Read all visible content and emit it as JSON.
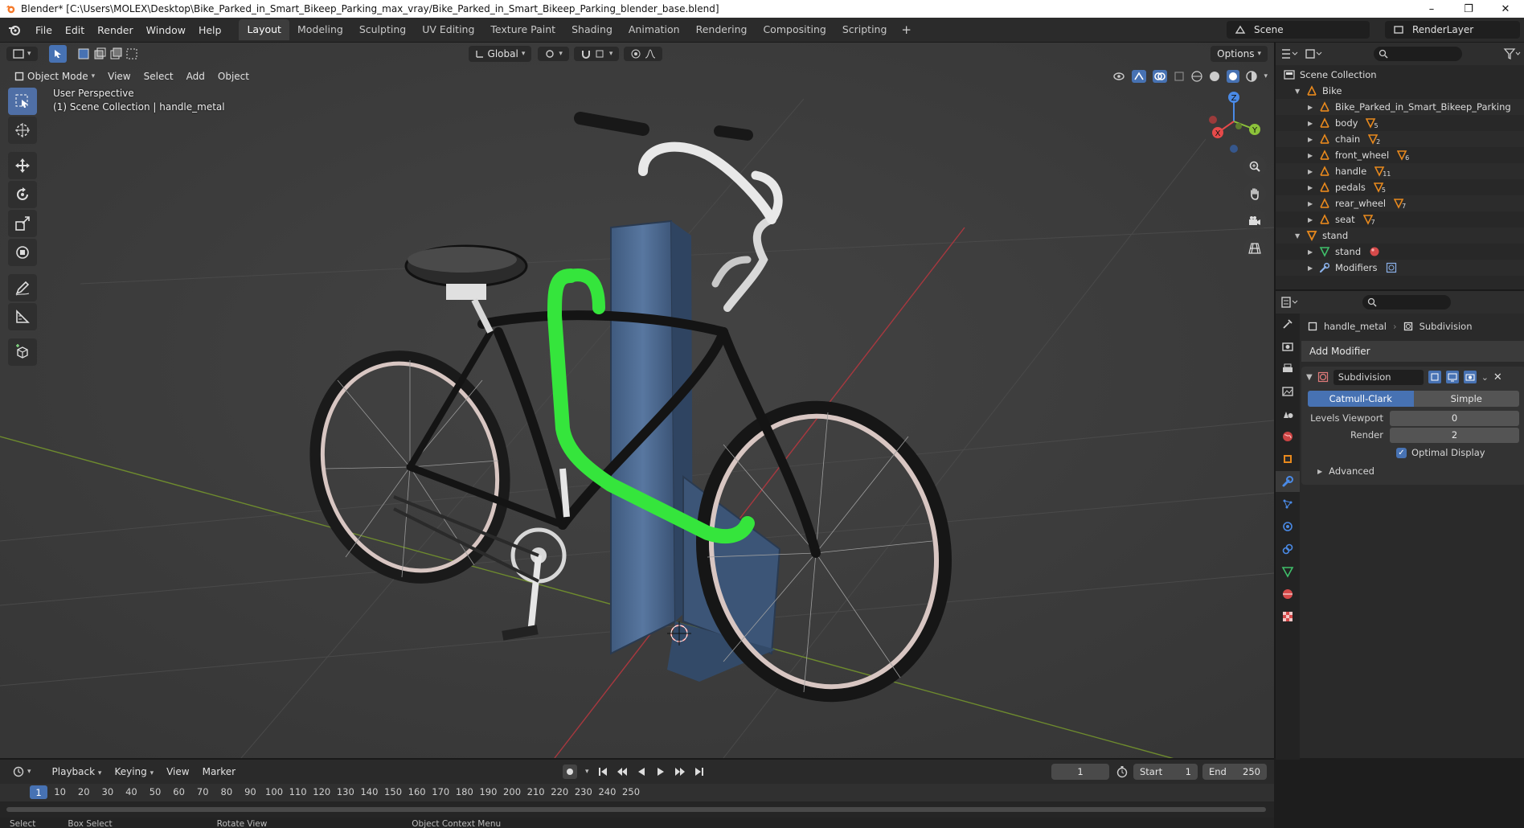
{
  "window": {
    "title": "Blender* [C:\\Users\\MOLEX\\Desktop\\Bike_Parked_in_Smart_Bikeep_Parking_max_vray/Bike_Parked_in_Smart_Bikeep_Parking_blender_base.blend]",
    "controls": [
      "–",
      "❐",
      "✕"
    ]
  },
  "menu": [
    "File",
    "Edit",
    "Render",
    "Window",
    "Help"
  ],
  "workspaces": [
    "Layout",
    "Modeling",
    "Sculpting",
    "UV Editing",
    "Texture Paint",
    "Shading",
    "Animation",
    "Rendering",
    "Compositing",
    "Scripting"
  ],
  "active_workspace": "Layout",
  "scene": "Scene",
  "render_layer": "RenderLayer",
  "viewport": {
    "transform_orientation": "Global",
    "options": "Options",
    "mode": "Object Mode",
    "header_menus": [
      "View",
      "Select",
      "Add",
      "Object"
    ],
    "overlay_line1": "User Perspective",
    "overlay_line2": "(1) Scene Collection | handle_metal",
    "gizmo": {
      "x": "X",
      "y": "Y",
      "z": "Z"
    }
  },
  "outliner": {
    "root": "Scene Collection",
    "rows": [
      {
        "label": "Bike",
        "level": 1,
        "expanded": true,
        "type": "empty"
      },
      {
        "label": "Bike_Parked_in_Smart_Bikeep_Parking",
        "level": 2,
        "type": "empty"
      },
      {
        "label": "body",
        "level": 2,
        "type": "empty",
        "badge": "5"
      },
      {
        "label": "chain",
        "level": 2,
        "type": "empty",
        "badge": "2"
      },
      {
        "label": "front_wheel",
        "level": 2,
        "type": "empty",
        "badge": "6"
      },
      {
        "label": "handle",
        "level": 2,
        "type": "empty",
        "badge": "11"
      },
      {
        "label": "pedals",
        "level": 2,
        "type": "empty",
        "badge": "5"
      },
      {
        "label": "rear_wheel",
        "level": 2,
        "type": "empty",
        "badge": "7"
      },
      {
        "label": "seat",
        "level": 2,
        "type": "empty",
        "badge": "7"
      },
      {
        "label": "stand",
        "level": 1,
        "expanded": true,
        "type": "mesh-obj"
      },
      {
        "label": "stand",
        "level": 2,
        "type": "mesh"
      },
      {
        "label": "Modifiers",
        "level": 2,
        "type": "modifier"
      }
    ]
  },
  "properties": {
    "object": "handle_metal",
    "modifier_crumb": "Subdivision",
    "add_modifier": "Add Modifier",
    "modifier": {
      "name": "Subdivision",
      "mode_on": "Catmull-Clark",
      "mode_off": "Simple",
      "levels_viewport_label": "Levels Viewport",
      "levels_viewport": "0",
      "render_label": "Render",
      "render": "2",
      "optimal_display": "Optimal Display",
      "advanced": "Advanced"
    }
  },
  "timeline": {
    "menus": [
      "Playback",
      "Keying",
      "View",
      "Marker"
    ],
    "current_frame": "1",
    "start_label": "Start",
    "start": "1",
    "end_label": "End",
    "end": "250",
    "ticks": [
      "10",
      "20",
      "30",
      "40",
      "50",
      "60",
      "70",
      "80",
      "90",
      "100",
      "110",
      "120",
      "130",
      "140",
      "150",
      "160",
      "170",
      "180",
      "190",
      "200",
      "210",
      "220",
      "230",
      "240",
      "250"
    ]
  },
  "status": [
    "Select",
    "Box Select",
    "Rotate View",
    "Object Context Menu"
  ],
  "colors": {
    "accent": "#4772b3",
    "selected_object": "#35e53c",
    "viewport_bg": "#3d3d3d",
    "axis_x": "#e64a4a",
    "axis_y": "#8cc23a",
    "axis_z": "#4a8ae6"
  }
}
